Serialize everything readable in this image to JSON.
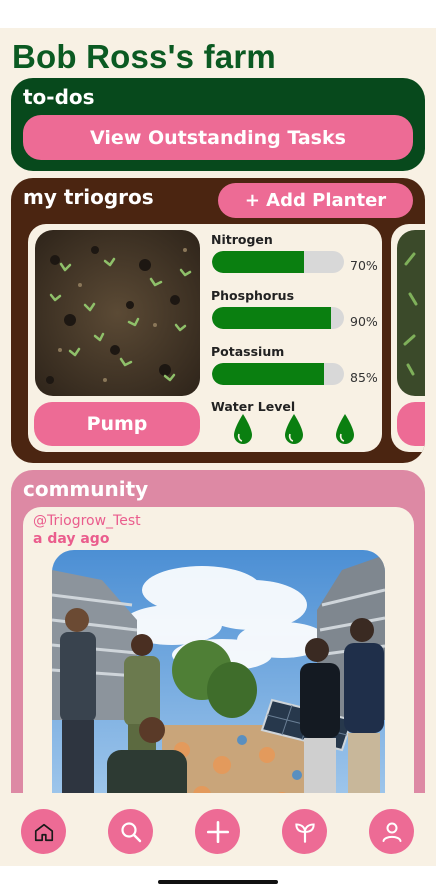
{
  "app": {
    "title": "Bob Ross's farm"
  },
  "todos": {
    "title": "to-dos",
    "button_label": "View Outstanding Tasks"
  },
  "triogros": {
    "title": "my triogros",
    "add_label": "+ Add Planter",
    "planter": {
      "pump_label": "Pump",
      "nutrients": [
        {
          "name": "Nitrogen",
          "percent_label": "70%",
          "value": 70
        },
        {
          "name": "Phosphorus",
          "percent_label": "90%",
          "value": 90
        },
        {
          "name": "Potassium",
          "percent_label": "85%",
          "value": 85
        }
      ],
      "water_label": "Water Level",
      "water_drops": 3
    }
  },
  "community": {
    "title": "community",
    "post": {
      "handle": "@Triogrow_Test",
      "time": "a day ago"
    }
  },
  "nav": {
    "items": [
      "home-icon",
      "search-icon",
      "plus-icon",
      "sprout-icon",
      "profile-icon"
    ]
  },
  "colors": {
    "title_green": "#0b5a22",
    "todos_bg": "#07491c",
    "triogros_bg": "#4b2511",
    "community_bg": "#dd89a4",
    "accent_pink": "#ed6b95",
    "bar_green": "#0a7f10",
    "background": "#f8f1e4"
  }
}
